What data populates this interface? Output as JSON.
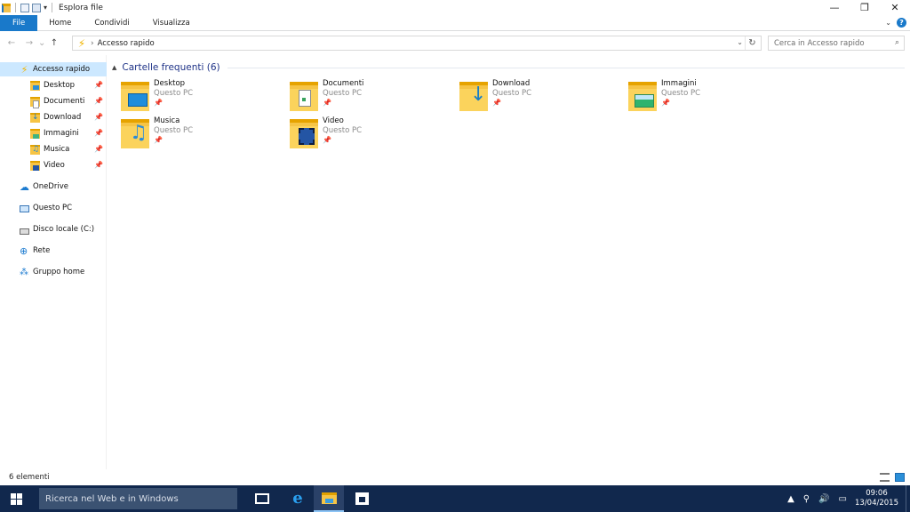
{
  "window": {
    "title": "Esplora file",
    "controls": {
      "minimize": "—",
      "restore": "❐",
      "close": "✕"
    }
  },
  "ribbon": {
    "tabs": [
      {
        "label": "File"
      },
      {
        "label": "Home"
      },
      {
        "label": "Condividi"
      },
      {
        "label": "Visualizza"
      }
    ],
    "help": "?"
  },
  "address": {
    "location": "Accesso rapido",
    "search_placeholder": "Cerca in Accesso rapido"
  },
  "sidebar": {
    "quick_access": "Accesso rapido",
    "pinned": [
      {
        "label": "Desktop",
        "icon": "desktop-folder-icon"
      },
      {
        "label": "Documenti",
        "icon": "documents-folder-icon"
      },
      {
        "label": "Download",
        "icon": "download-folder-icon"
      },
      {
        "label": "Immagini",
        "icon": "pictures-folder-icon"
      },
      {
        "label": "Musica",
        "icon": "music-folder-icon"
      },
      {
        "label": "Video",
        "icon": "video-folder-icon"
      }
    ],
    "locations": [
      {
        "label": "OneDrive",
        "icon": "onedrive-icon"
      },
      {
        "label": "Questo PC",
        "icon": "this-pc-icon"
      },
      {
        "label": "Disco locale (C:)",
        "icon": "local-disk-icon"
      },
      {
        "label": "Rete",
        "icon": "network-icon"
      },
      {
        "label": "Gruppo home",
        "icon": "homegroup-icon"
      }
    ]
  },
  "main": {
    "group_title": "Cartelle frequenti (6)",
    "folders": [
      {
        "name": "Desktop",
        "location": "Questo PC",
        "icon": "desktop-folder-icon"
      },
      {
        "name": "Documenti",
        "location": "Questo PC",
        "icon": "documents-folder-icon"
      },
      {
        "name": "Download",
        "location": "Questo PC",
        "icon": "download-folder-icon"
      },
      {
        "name": "Immagini",
        "location": "Questo PC",
        "icon": "pictures-folder-icon"
      },
      {
        "name": "Musica",
        "location": "Questo PC",
        "icon": "music-folder-icon"
      },
      {
        "name": "Video",
        "location": "Questo PC",
        "icon": "video-folder-icon"
      }
    ]
  },
  "status": {
    "count": "6 elementi"
  },
  "taskbar": {
    "search_placeholder": "Ricerca nel Web e in Windows",
    "time": "09:06",
    "date": "13/04/2015"
  },
  "colors": {
    "accent": "#1979ca",
    "selection": "#cce8ff",
    "group_title": "#1e3287",
    "taskbar": "#11284d"
  }
}
